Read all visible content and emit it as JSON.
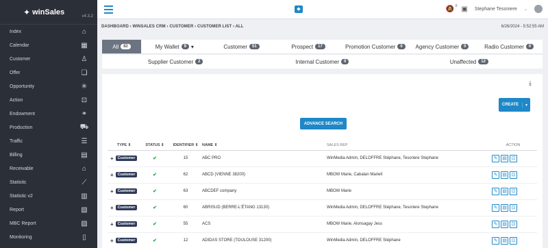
{
  "brand": {
    "name": "winSales",
    "version": "v4.3.2"
  },
  "sidebar": {
    "items": [
      {
        "label": "Index",
        "icon": "home-icon"
      },
      {
        "label": "Calendar",
        "icon": "calendar-icon"
      },
      {
        "label": "Customer",
        "icon": "customer-icon"
      },
      {
        "label": "Offer",
        "icon": "offer-icon"
      },
      {
        "label": "Opportunity",
        "icon": "opportunity-icon"
      },
      {
        "label": "Action",
        "icon": "briefcase-icon"
      },
      {
        "label": "Endowment",
        "icon": "handshake-icon"
      },
      {
        "label": "Production",
        "icon": "production-icon"
      },
      {
        "label": "Traffic",
        "icon": "list-icon"
      },
      {
        "label": "Billing",
        "icon": "billing-icon"
      },
      {
        "label": "Receivable",
        "icon": "bank-icon"
      },
      {
        "label": "Statistic",
        "icon": "chart-icon"
      },
      {
        "label": "Statistic v2",
        "icon": "bar-chart-icon"
      },
      {
        "label": "Report",
        "icon": "report-icon"
      },
      {
        "label": "MBC Report",
        "icon": "mbc-report-icon"
      },
      {
        "label": "Monitoring",
        "icon": "map-icon"
      }
    ]
  },
  "topbar": {
    "username": "Stephane Tesoniere",
    "notification_count": "0"
  },
  "breadcrumb": {
    "path": "DASHBOARD › WINSALES CRM › CUSTOMER › CUSTOMER LIST › ALL",
    "timestamp": "6/26/2024 - 5:52:55 AM"
  },
  "tabs_row1": [
    {
      "label": "All",
      "count": "82"
    },
    {
      "label": "My Wallet",
      "count": "9"
    },
    {
      "label": "Customer",
      "count": "51"
    },
    {
      "label": "Prospect",
      "count": "17"
    },
    {
      "label": "Promotion Customer",
      "count": "0"
    },
    {
      "label": "Agency Customer",
      "count": "0"
    },
    {
      "label": "Radio Customer",
      "count": "0"
    }
  ],
  "tabs_row2": [
    {
      "label": "Supplier Customer",
      "count": "2"
    },
    {
      "label": "Internal Customer",
      "count": "0"
    },
    {
      "label": "Unaffected",
      "count": "12"
    }
  ],
  "buttons": {
    "create": "CREATE",
    "advanced_search": "ADVANCE SEARCH"
  },
  "table": {
    "headers": {
      "type": "TYPE ⇕",
      "status": "STATUS ⇕",
      "identifier": "IDENTIFIER ⇕",
      "name": "NAME ⇕",
      "sales_rep": "SALES REP",
      "action": "ACTION"
    },
    "rows": [
      {
        "type": "Customer",
        "identifier": "15",
        "name": "ABC PRO",
        "sales_rep": "WinMedia Admin, DELOFFRE Stéphane, Tesoriere Stephane"
      },
      {
        "type": "Customer",
        "identifier": "62",
        "name": "ABCD (VIENNE 38200)",
        "sales_rep": "MBOW Marie, Cabalan Mariell"
      },
      {
        "type": "Customer",
        "identifier": "63",
        "name": "ABCDEF company",
        "sales_rep": "MBOW Marie"
      },
      {
        "type": "Customer",
        "identifier": "60",
        "name": "ABRISUD (BERRE-L'ÉTANG 13130)",
        "sales_rep": "WinMedia Admin, DELOFFRE Stéphane, Tesoriere Stephane"
      },
      {
        "type": "Customer",
        "identifier": "55",
        "name": "ACS",
        "sales_rep": "MBOW Marie, Alonsagay Jess"
      },
      {
        "type": "Customer",
        "identifier": "12",
        "name": "ADIDAS STORE (TOULOUSE 31200)",
        "sales_rep": "WinMedia Admin, DELOFFRE Stéphane"
      }
    ]
  }
}
